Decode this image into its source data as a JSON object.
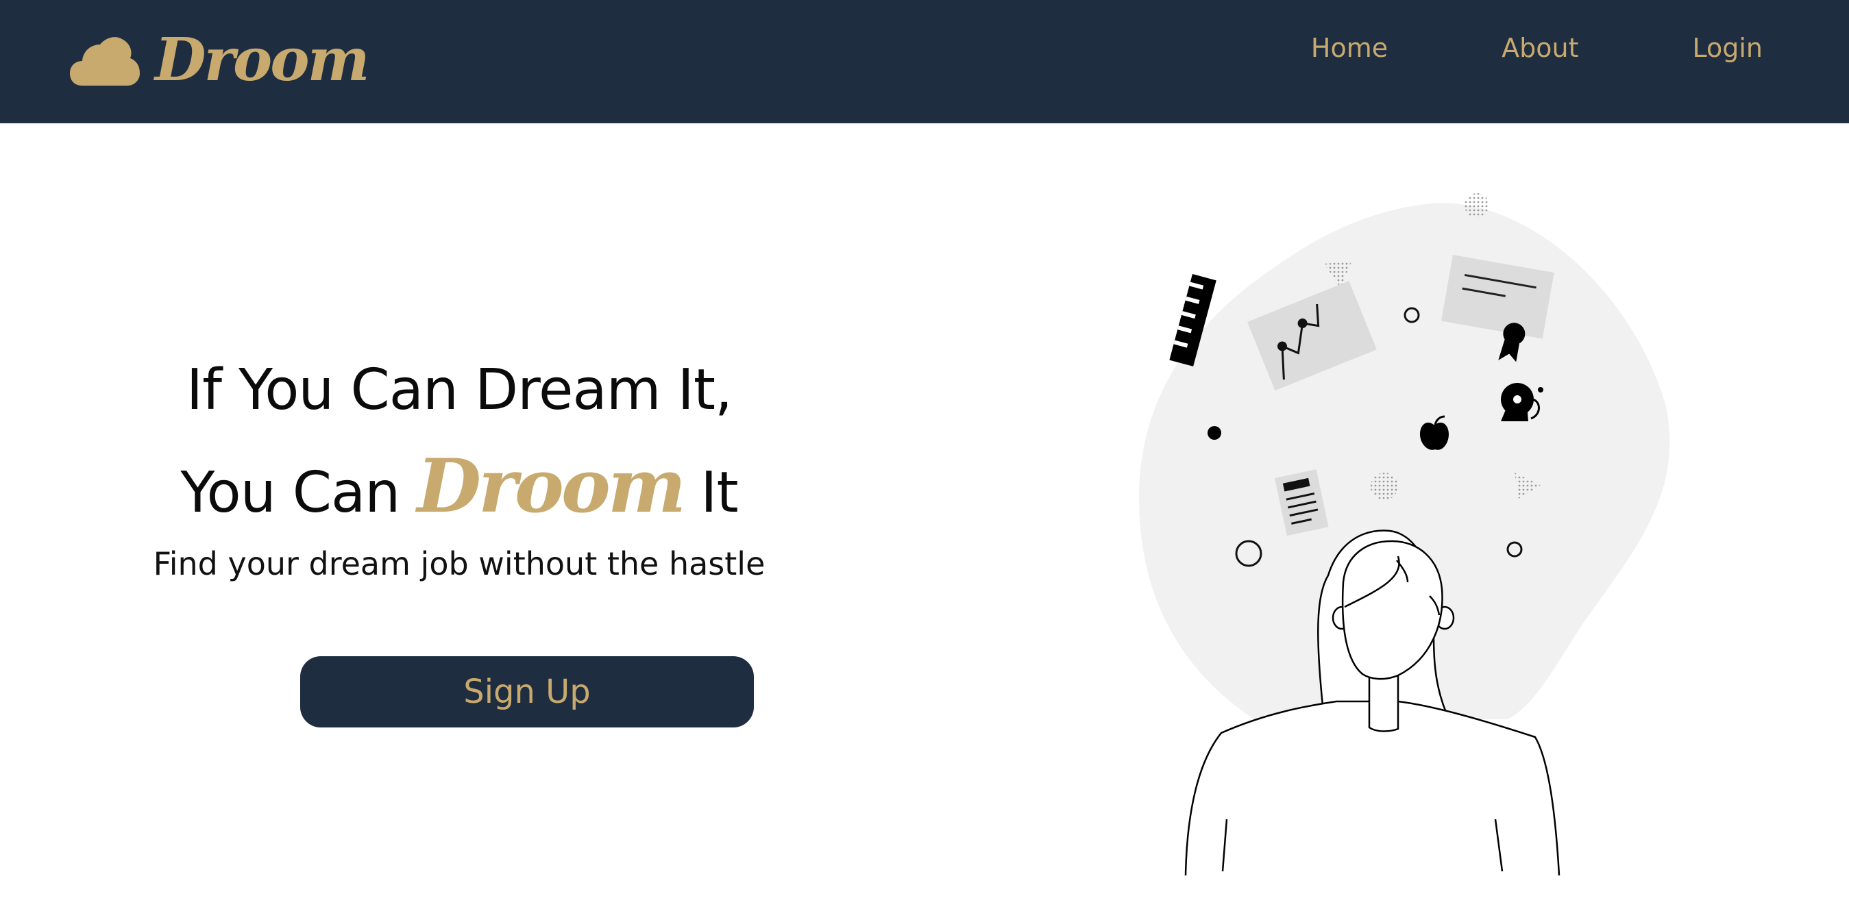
{
  "brand": {
    "name": "Droom",
    "color": "#c8a96e",
    "icon": "cloud-icon"
  },
  "nav": {
    "background": "#1f2d40",
    "links": [
      {
        "label": "Home"
      },
      {
        "label": "About"
      },
      {
        "label": "Login"
      }
    ]
  },
  "hero": {
    "headline_line1": "If You Can Dream It,",
    "headline_line2_prefix": "You Can ",
    "headline_brand": "Droom",
    "headline_line2_suffix": " It",
    "subtitle": "Find your dream job without the hastle",
    "cta_label": "Sign Up"
  },
  "illustration": {
    "description_icons": [
      "ruler-icon",
      "chart-card-icon",
      "certificate-icon",
      "apple-icon",
      "alarm-bell-icon",
      "document-icon",
      "person-illustration"
    ]
  }
}
